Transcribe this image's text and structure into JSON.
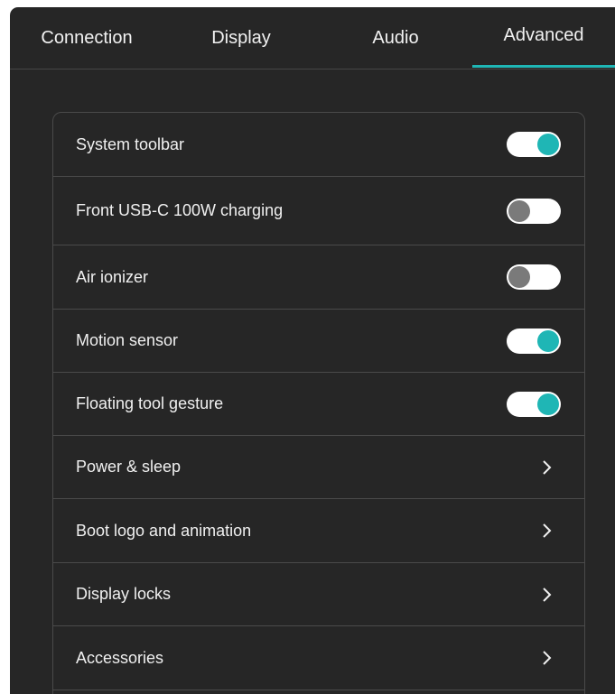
{
  "tabs": [
    {
      "label": "Connection",
      "active": false
    },
    {
      "label": "Display",
      "active": false
    },
    {
      "label": "Audio",
      "active": false
    },
    {
      "label": "Advanced",
      "active": true
    }
  ],
  "colors": {
    "accent": "#1fb6b5",
    "background": "#262626",
    "divider": "#4a4a4a",
    "toggle_off_knob": "#7a7a7a"
  },
  "settings": [
    {
      "label": "System toolbar",
      "control": "toggle",
      "on": true
    },
    {
      "label": "Front USB-C 100W charging",
      "control": "toggle",
      "on": false
    },
    {
      "label": "Air ionizer",
      "control": "toggle",
      "on": false
    },
    {
      "label": "Motion sensor",
      "control": "toggle",
      "on": true
    },
    {
      "label": "Floating tool gesture",
      "control": "toggle",
      "on": true
    },
    {
      "label": "Power & sleep",
      "control": "chevron-right-icon"
    },
    {
      "label": "Boot logo and animation",
      "control": "chevron-right-icon"
    },
    {
      "label": "Display locks",
      "control": "chevron-right-icon"
    },
    {
      "label": "Accessories",
      "control": "chevron-right-icon"
    }
  ]
}
